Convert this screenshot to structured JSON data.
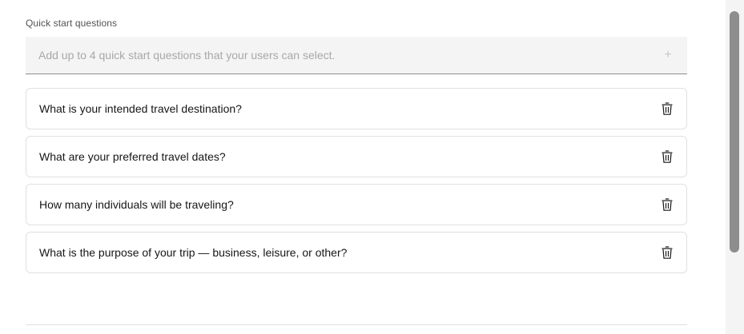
{
  "section": {
    "label": "Quick start questions"
  },
  "add_question": {
    "placeholder": "Add up to 4 quick start questions that your users can select.",
    "value": "",
    "add_icon": "plus-icon",
    "add_glyph": "+"
  },
  "questions": [
    {
      "text": "What is your intended travel destination?",
      "icon": "trash-icon"
    },
    {
      "text": "What are your preferred travel dates?",
      "icon": "trash-icon"
    },
    {
      "text": "How many individuals will be traveling?",
      "icon": "trash-icon"
    },
    {
      "text": "What is the purpose of your trip — business, leisure, or other?",
      "icon": "trash-icon"
    }
  ],
  "colors": {
    "input_background": "#f4f4f4",
    "card_border": "#e0e0e0",
    "text": "#161616",
    "placeholder": "#a8a8a8",
    "scrollbar_thumb": "#8d8d8d"
  }
}
